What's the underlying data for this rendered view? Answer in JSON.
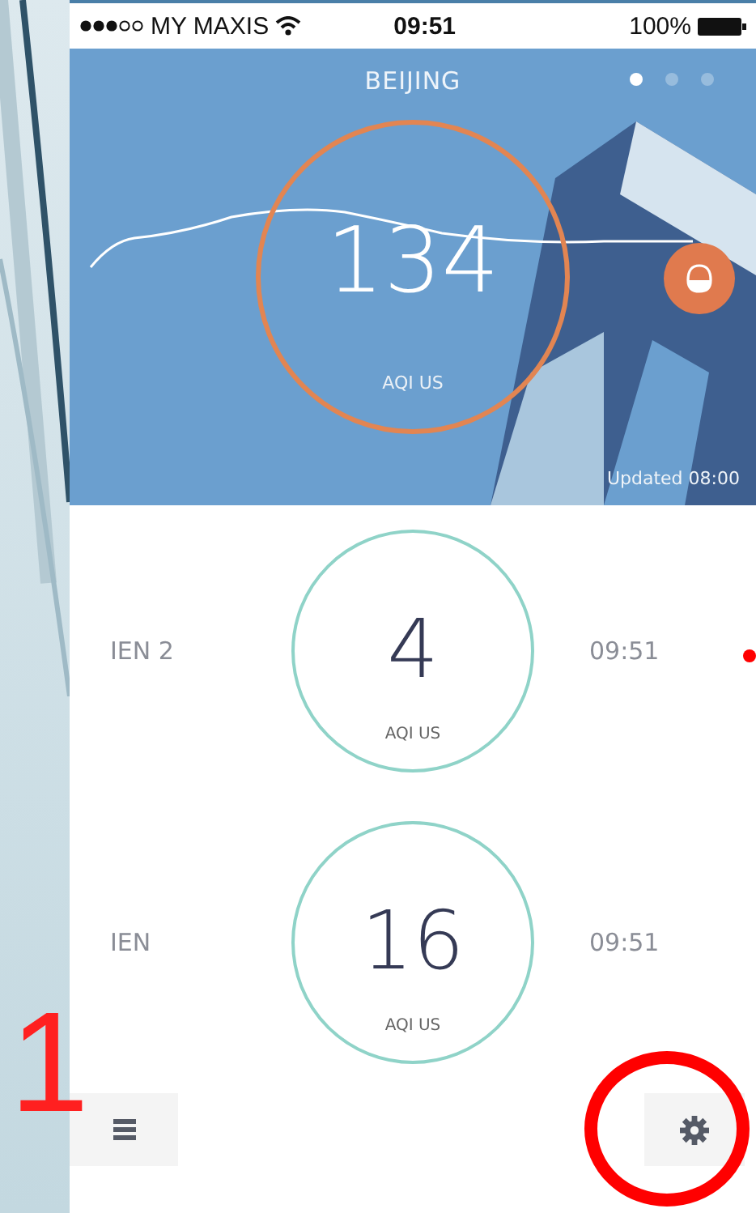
{
  "slide": {
    "page_number": "1"
  },
  "status_bar": {
    "carrier": "MY MAXIS",
    "time": "09:51",
    "battery": "100%"
  },
  "hero": {
    "city": "BEIJING",
    "pages": [
      {
        "selected": true
      },
      {
        "selected": false
      },
      {
        "selected": false
      }
    ],
    "aqi": "134",
    "unit": "AQI US",
    "updated": "Updated 08:00"
  },
  "stations": [
    {
      "name": "IEN 2",
      "aqi": "4",
      "unit": "AQI US",
      "time": "09:51"
    },
    {
      "name": "IEN",
      "aqi": "16",
      "unit": "AQI US",
      "time": "09:51"
    }
  ]
}
